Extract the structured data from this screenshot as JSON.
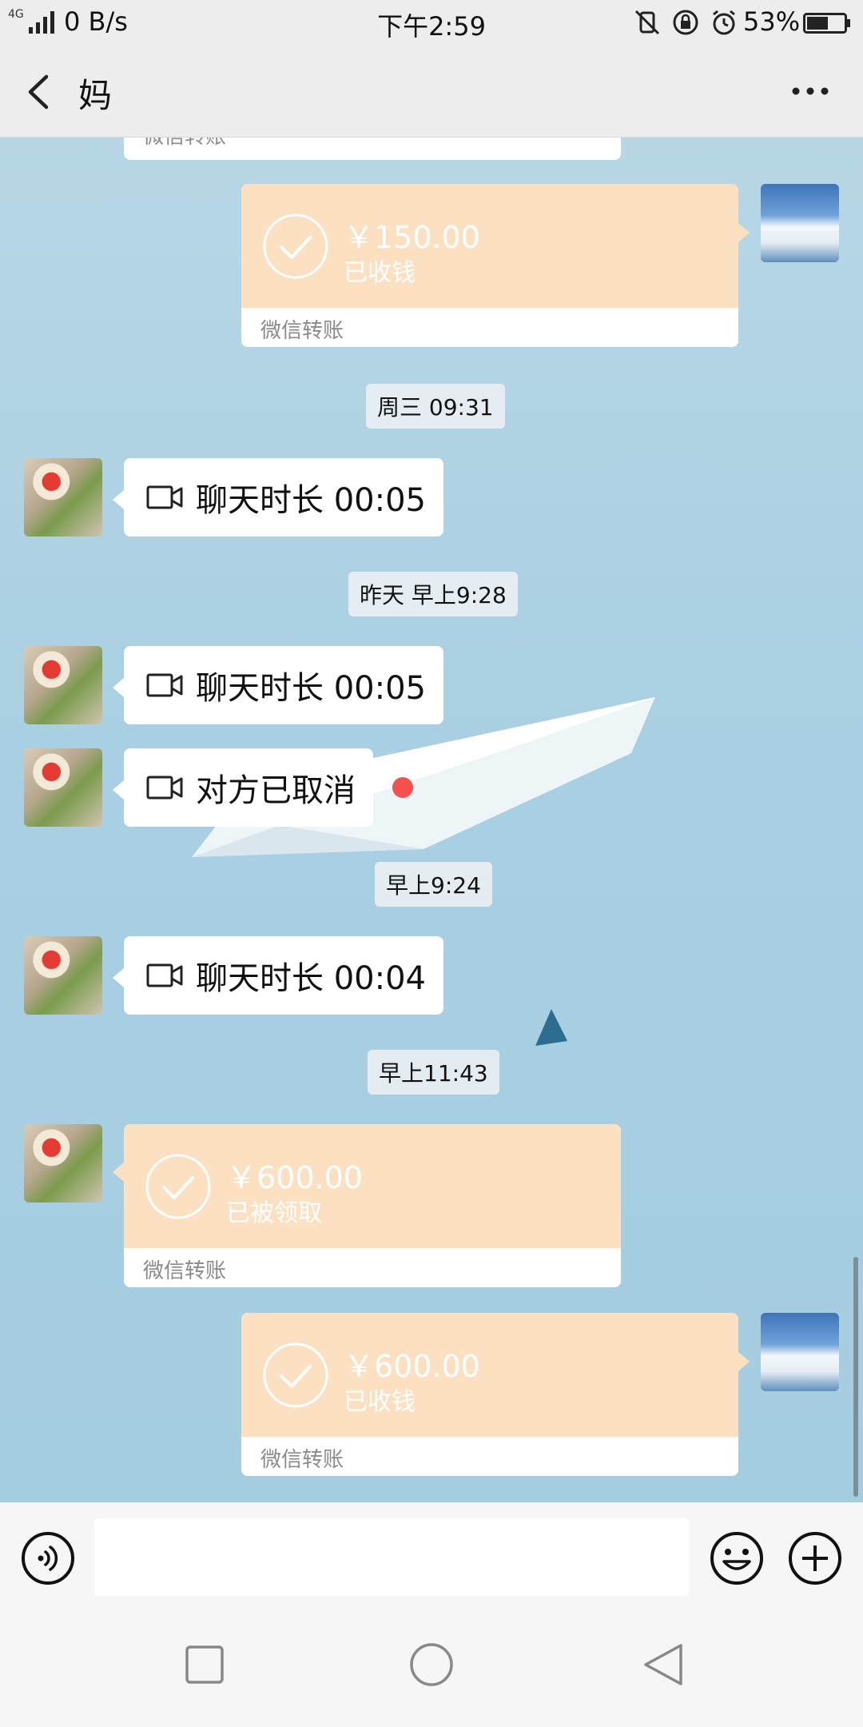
{
  "status_bar": {
    "network": "4G",
    "speed": "0 B/s",
    "time": "下午2:59",
    "battery_pct": "53%"
  },
  "header": {
    "title": "妈"
  },
  "messages": {
    "transfer_top_partial": {
      "label": "微信转账"
    },
    "transfer1": {
      "amount": "￥150.00",
      "status": "已收钱",
      "label": "微信转账"
    },
    "time1": "周三 09:31",
    "call1": "聊天时长 00:05",
    "time2": "昨天 早上9:28",
    "call2": "聊天时长 00:05",
    "call3": "对方已取消",
    "time3": "早上9:24",
    "call4": "聊天时长 00:04",
    "time4": "早上11:43",
    "transfer2": {
      "amount": "￥600.00",
      "status": "已被领取",
      "label": "微信转账"
    },
    "transfer3": {
      "amount": "￥600.00",
      "status": "已收钱",
      "label": "微信转账"
    }
  },
  "input": {
    "value": "",
    "placeholder": ""
  },
  "colors": {
    "transfer_bg": "#fce0c2",
    "chat_bg": "#a9cfe2",
    "unread_dot": "#f4514d"
  },
  "icons": [
    "back-arrow-icon",
    "more-icon",
    "video-call-icon",
    "check-circle-icon",
    "voice-icon",
    "emoji-icon",
    "plus-icon",
    "nav-recent-icon",
    "nav-home-icon",
    "nav-back-icon"
  ]
}
